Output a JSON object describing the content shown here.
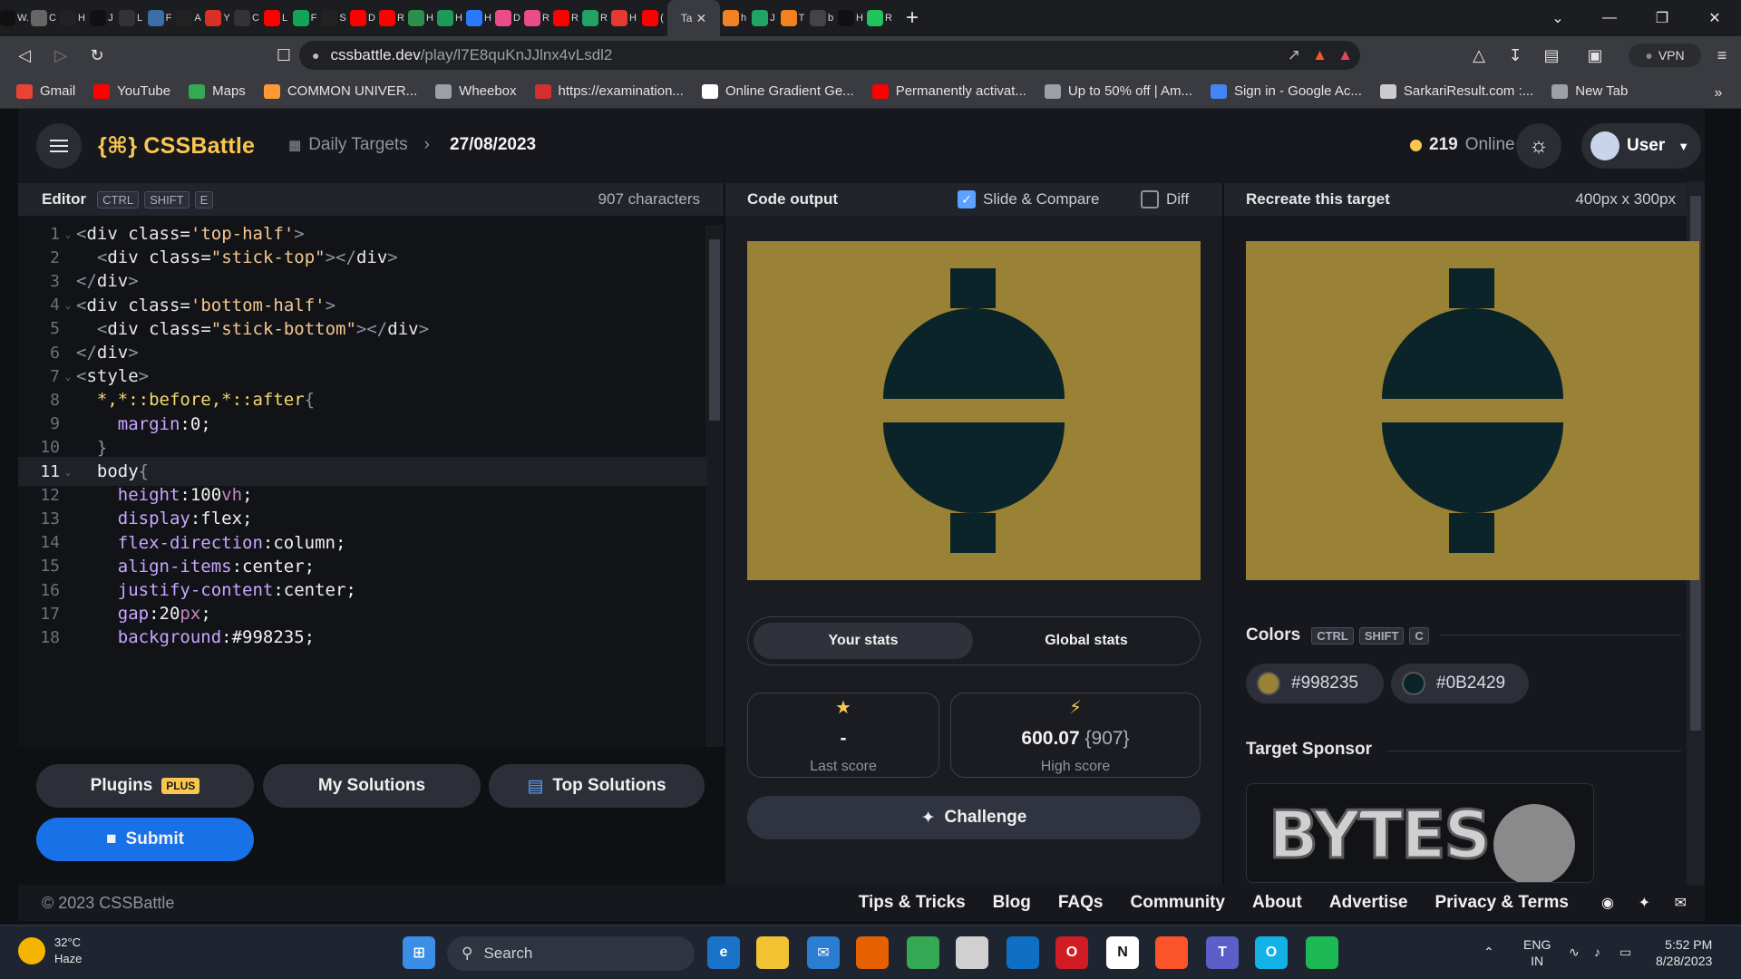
{
  "browser": {
    "tabs": [
      {
        "label": "W.",
        "color": "#111111"
      },
      {
        "label": "C",
        "color": "#666666"
      },
      {
        "label": "H",
        "color": "#222222"
      },
      {
        "label": "J",
        "color": "#111111"
      },
      {
        "label": "L",
        "color": "#333333"
      },
      {
        "label": "F",
        "color": "#3a6ea5"
      },
      {
        "label": "A",
        "color": "#222222"
      },
      {
        "label": "Y",
        "color": "#d93025"
      },
      {
        "label": "C",
        "color": "#333333"
      },
      {
        "label": "L",
        "color": "#ff0000"
      },
      {
        "label": "F",
        "color": "#12a454"
      },
      {
        "label": "S",
        "color": "#222222"
      },
      {
        "label": "D",
        "color": "#ff0000"
      },
      {
        "label": "R",
        "color": "#ff0000"
      },
      {
        "label": "H",
        "color": "#2c8f4b"
      },
      {
        "label": "H",
        "color": "#1b9a5a"
      },
      {
        "label": "H",
        "color": "#2979ff"
      },
      {
        "label": "D",
        "color": "#ea4c89"
      },
      {
        "label": "R",
        "color": "#ea4c89"
      },
      {
        "label": "R",
        "color": "#ff0000"
      },
      {
        "label": "R",
        "color": "#21a366"
      },
      {
        "label": "H",
        "color": "#e53935"
      },
      {
        "label": "(",
        "color": "#ff0000"
      }
    ],
    "active_tab": {
      "label": "Ta"
    },
    "tabs_after": [
      {
        "label": "h",
        "color": "#f48024"
      },
      {
        "label": "J",
        "color": "#21a366"
      },
      {
        "label": "T",
        "color": "#f4811f"
      },
      {
        "label": "b",
        "color": "#444444"
      },
      {
        "label": "H",
        "color": "#111111"
      },
      {
        "label": "R",
        "color": "#21c35d"
      }
    ],
    "url_host": "cssbattle.dev",
    "url_path": "/play/l7E8quKnJJlnx4vLsdl2",
    "vpn_label": "VPN",
    "bookmarks": [
      {
        "label": "Gmail",
        "color": "#ea4335"
      },
      {
        "label": "YouTube",
        "color": "#ff0000"
      },
      {
        "label": "Maps",
        "color": "#34a853"
      },
      {
        "label": "COMMON UNIVER...",
        "color": "#ff9933"
      },
      {
        "label": "Wheebox",
        "color": "#9aa0a6"
      },
      {
        "label": "https://examination...",
        "color": "#d32f2f"
      },
      {
        "label": "Online Gradient Ge...",
        "color": "#ffffff"
      },
      {
        "label": "Permanently activat...",
        "color": "#ff0000"
      },
      {
        "label": "Up to 50% off | Am...",
        "color": "#9aa0a6"
      },
      {
        "label": "Sign in - Google Ac...",
        "color": "#4285f4"
      },
      {
        "label": "SarkariResult.com :...",
        "color": "#cccccc"
      },
      {
        "label": "New Tab",
        "color": "#9aa0a6"
      }
    ]
  },
  "header": {
    "logo_mark": "{⌘}",
    "logo_text": "CSSBattle",
    "breadcrumb_section": "Daily Targets",
    "breadcrumb_date": "27/08/2023",
    "online_count": "219",
    "online_label": "Online",
    "user_label": "User"
  },
  "editor": {
    "title": "Editor",
    "shortcut_keys": [
      "CTRL",
      "SHIFT",
      "E"
    ],
    "char_count": "907 characters",
    "active_line": 11,
    "lines": [
      {
        "n": "1",
        "fold": true,
        "html": "<span class='pu'>&lt;</span><span class='tg'>div</span> <span class='at'>class=</span><span class='st'>'top-half'</span><span class='pu'>&gt;</span>"
      },
      {
        "n": "2",
        "fold": false,
        "html": "  <span class='pu'>&lt;</span><span class='tg'>div</span> <span class='at'>class=</span><span class='st'>\"stick-top\"</span><span class='pu'>&gt;&lt;/</span><span class='tg'>div</span><span class='pu'>&gt;</span>"
      },
      {
        "n": "3",
        "fold": false,
        "html": "<span class='pu'>&lt;/</span><span class='tg'>div</span><span class='pu'>&gt;</span>"
      },
      {
        "n": "4",
        "fold": true,
        "html": "<span class='pu'>&lt;</span><span class='tg'>div</span> <span class='at'>class=</span><span class='st'>'bottom-half'</span><span class='pu'>&gt;</span>"
      },
      {
        "n": "5",
        "fold": false,
        "html": "  <span class='pu'>&lt;</span><span class='tg'>div</span> <span class='at'>class=</span><span class='st'>\"stick-bottom\"</span><span class='pu'>&gt;&lt;/</span><span class='tg'>div</span><span class='pu'>&gt;</span>"
      },
      {
        "n": "6",
        "fold": false,
        "html": "<span class='pu'>&lt;/</span><span class='tg'>div</span><span class='pu'>&gt;</span>"
      },
      {
        "n": "7",
        "fold": true,
        "html": "<span class='pu'>&lt;</span><span class='tg'>style</span><span class='pu'>&gt;</span>"
      },
      {
        "n": "8",
        "fold": false,
        "html": "  <span class='sel'>*,*::before,*::after</span><span class='pu'>{</span>"
      },
      {
        "n": "9",
        "fold": false,
        "html": "    <span class='pr'>margin</span><span class='vl'>:0;</span>"
      },
      {
        "n": "10",
        "fold": false,
        "html": "  <span class='pu'>}</span>"
      },
      {
        "n": "11",
        "fold": true,
        "html": "  <span class='vl'>body</span><span class='pu'>{</span>"
      },
      {
        "n": "12",
        "fold": false,
        "html": "    <span class='pr'>height</span><span class='vl'>:100</span><span class='kw'>vh</span><span class='vl'>;</span>"
      },
      {
        "n": "13",
        "fold": false,
        "html": "    <span class='pr'>display</span><span class='vl'>:flex;</span>"
      },
      {
        "n": "14",
        "fold": false,
        "html": "    <span class='pr'>flex-direction</span><span class='vl'>:column;</span>"
      },
      {
        "n": "15",
        "fold": false,
        "html": "    <span class='pr'>align-items</span><span class='vl'>:center;</span>"
      },
      {
        "n": "16",
        "fold": false,
        "html": "    <span class='pr'>justify-content</span><span class='vl'>:center;</span>"
      },
      {
        "n": "17",
        "fold": false,
        "html": "    <span class='pr'>gap</span><span class='vl'>:20</span><span class='kw'>px</span><span class='vl'>;</span>"
      },
      {
        "n": "18",
        "fold": false,
        "html": "    <span class='pr'>background</span><span class='vl'>:#998235;</span>"
      }
    ],
    "buttons": {
      "plugins": "Plugins",
      "plus_badge": "PLUS",
      "my_solutions": "My Solutions",
      "top_solutions": "Top Solutions",
      "submit": "Submit"
    }
  },
  "output": {
    "title": "Code output",
    "slide_compare_label": "Slide & Compare",
    "slide_compare_checked": true,
    "diff_label": "Diff",
    "diff_checked": false,
    "stats_tabs": [
      "Your stats",
      "Global stats"
    ],
    "last_score_value": "-",
    "last_score_label": "Last score",
    "high_score_value": "600.07",
    "high_score_chars": "{907}",
    "high_score_label": "High score",
    "challenge_label": "Challenge"
  },
  "target": {
    "title": "Recreate this target",
    "size": "400px x 300px",
    "colors_label": "Colors",
    "colors_keys": [
      "CTRL",
      "SHIFT",
      "C"
    ],
    "colors": [
      {
        "hex": "#998235"
      },
      {
        "hex": "#0B2429"
      }
    ],
    "sponsor_title": "Target Sponsor",
    "sponsor_text": "BYTES"
  },
  "footer": {
    "copyright": "© 2023 CSSBattle",
    "links": [
      "Tips & Tricks",
      "Blog",
      "FAQs",
      "Community",
      "About",
      "Advertise",
      "Privacy & Terms"
    ]
  },
  "taskbar": {
    "temp": "32°C",
    "weather": "Haze",
    "search_label": "Search",
    "lang_top": "ENG",
    "lang_bottom": "IN",
    "time": "5:52 PM",
    "date": "8/28/2023"
  }
}
